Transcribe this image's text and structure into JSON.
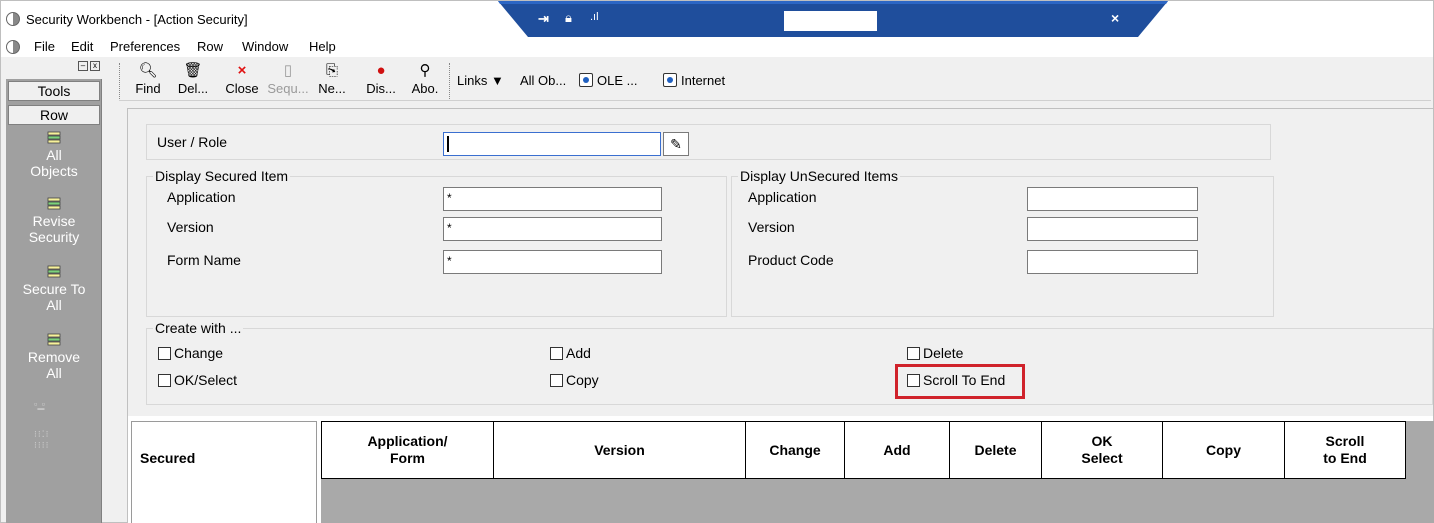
{
  "window": {
    "title": "Security Workbench - [Action Security]"
  },
  "remote_bar": {
    "pin_icon": "pin-icon",
    "lock_icon": "lock-icon",
    "signal_icon": "signal-icon",
    "close_label": "×"
  },
  "menu": {
    "items": [
      "File",
      "Edit",
      "Preferences",
      "Row",
      "Window",
      "Help"
    ]
  },
  "left_panel": {
    "tools_label": "Tools",
    "row_label": "Row",
    "items": [
      {
        "label_1": "All",
        "label_2": "Objects"
      },
      {
        "label_1": "Revise",
        "label_2": "Security"
      },
      {
        "label_1": "Secure To",
        "label_2": "All"
      },
      {
        "label_1": "Remove",
        "label_2": "All"
      }
    ]
  },
  "toolbar": {
    "buttons": [
      {
        "label": "Find",
        "icon": "find-icon"
      },
      {
        "label": "Del...",
        "icon": "trash-icon"
      },
      {
        "label": "Close",
        "icon": "close-x-icon"
      },
      {
        "label": "Sequ...",
        "icon": "sequence-icon"
      },
      {
        "label": "Ne...",
        "icon": "new-icon"
      },
      {
        "label": "Dis...",
        "icon": "display-icon"
      },
      {
        "label": "Abo.",
        "icon": "about-icon"
      }
    ],
    "links_label": "Links",
    "all_objects_label": "All Ob...",
    "ole_label": "OLE ...",
    "internet_label": "Internet"
  },
  "form": {
    "user_role_label": "User / Role",
    "user_role_value": "",
    "display_secured": {
      "legend": "Display Secured Item",
      "application_label": "Application",
      "application_value": "*",
      "version_label": "Version",
      "version_value": "*",
      "form_name_label": "Form Name",
      "form_name_value": "*"
    },
    "display_unsecured": {
      "legend": "Display UnSecured Items",
      "application_label": "Application",
      "application_value": "",
      "version_label": "Version",
      "version_value": "",
      "product_code_label": "Product Code",
      "product_code_value": ""
    },
    "create_with": {
      "legend": "Create with ...",
      "change": "Change",
      "ok_select": "OK/Select",
      "add": "Add",
      "copy": "Copy",
      "delete": "Delete",
      "scroll_to_end": "Scroll To End"
    }
  },
  "grid": {
    "secured_label": "Secured",
    "columns": [
      {
        "line1": "Application/",
        "line2": "Form"
      },
      {
        "line1": "Version",
        "line2": ""
      },
      {
        "line1": "Change",
        "line2": ""
      },
      {
        "line1": "Add",
        "line2": ""
      },
      {
        "line1": "Delete",
        "line2": ""
      },
      {
        "line1": "OK",
        "line2": "Select"
      },
      {
        "line1": "Copy",
        "line2": ""
      },
      {
        "line1": "Scroll",
        "line2": "to End"
      }
    ]
  },
  "colors": {
    "highlight": "#d0222b",
    "remote_bar": "#1f4e9c"
  }
}
